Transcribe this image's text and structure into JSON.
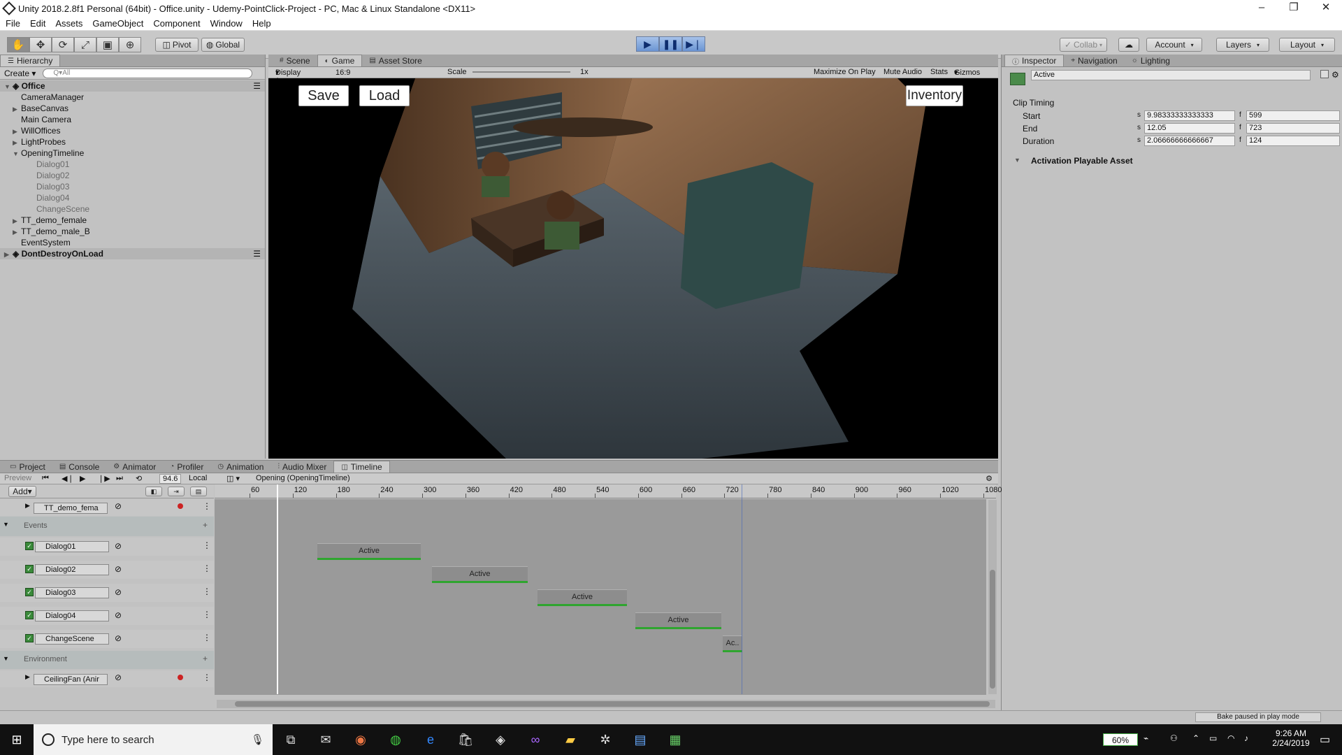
{
  "window": {
    "title": "Unity 2018.2.8f1 Personal (64bit) - Office.unity - Udemy-PointClick-Project - PC, Mac & Linux Standalone <DX11>"
  },
  "menu": [
    "File",
    "Edit",
    "Assets",
    "GameObject",
    "Component",
    "Window",
    "Help"
  ],
  "toolbar": {
    "pivot": "Pivot",
    "global": "Global",
    "collab": "Collab",
    "account": "Account",
    "layers": "Layers",
    "layout": "Layout"
  },
  "hierarchy": {
    "tab": "Hierarchy",
    "create": "Create",
    "search_placeholder": "Q▾All",
    "items": [
      {
        "label": "Office",
        "type": "scene",
        "expanded": true
      },
      {
        "label": "CameraManager",
        "indent": 1
      },
      {
        "label": "BaseCanvas",
        "indent": 1,
        "collapsed": true
      },
      {
        "label": "Main Camera",
        "indent": 1
      },
      {
        "label": "WillOffices",
        "indent": 1,
        "collapsed": true
      },
      {
        "label": "LightProbes",
        "indent": 1,
        "collapsed": true
      },
      {
        "label": "OpeningTimeline",
        "indent": 1,
        "expanded": true
      },
      {
        "label": "Dialog01",
        "indent": 2,
        "dim": true
      },
      {
        "label": "Dialog02",
        "indent": 2,
        "dim": true
      },
      {
        "label": "Dialog03",
        "indent": 2,
        "dim": true
      },
      {
        "label": "Dialog04",
        "indent": 2,
        "dim": true
      },
      {
        "label": "ChangeScene",
        "indent": 2,
        "dim": true
      },
      {
        "label": "TT_demo_female",
        "indent": 1,
        "collapsed": true
      },
      {
        "label": "TT_demo_male_B",
        "indent": 1,
        "collapsed": true
      },
      {
        "label": "EventSystem",
        "indent": 1
      },
      {
        "label": "DontDestroyOnLoad",
        "type": "scene",
        "collapsed": true
      }
    ]
  },
  "gameview": {
    "tabs": [
      "Scene",
      "Game",
      "Asset Store"
    ],
    "active_tab": "Game",
    "display": "Display 1",
    "aspect": "16:9",
    "scale_label": "Scale",
    "scale_value": "1x",
    "toggles": [
      "Maximize On Play",
      "Mute Audio",
      "Stats",
      "Gizmos"
    ],
    "buttons": {
      "save": "Save",
      "load": "Load",
      "inventory": "Inventory"
    }
  },
  "inspector": {
    "tabs": [
      "Inspector",
      "Navigation",
      "Lighting"
    ],
    "name": "Active",
    "clip_timing": "Clip Timing",
    "rows": [
      {
        "label": "Start",
        "s": "9.98333333333333",
        "f": "599"
      },
      {
        "label": "End",
        "s": "12.05",
        "f": "723"
      },
      {
        "label": "Duration",
        "s": "2.06666666666667",
        "f": "124"
      }
    ],
    "unit_s": "s",
    "unit_f": "f",
    "section": "Activation Playable Asset"
  },
  "timeline": {
    "tabs": [
      "Project",
      "Console",
      "Animator",
      "Profiler",
      "Animation",
      "Audio Mixer",
      "Timeline"
    ],
    "active_tab": "Timeline",
    "preview": "Preview",
    "frame": "94.6",
    "local": "Local",
    "asset": "Opening (OpeningTimeline)",
    "add": "Add",
    "ruler": [
      "60",
      "120",
      "180",
      "240",
      "300",
      "360",
      "420",
      "480",
      "540",
      "600",
      "660",
      "720",
      "780",
      "840",
      "900",
      "960",
      "1020",
      "1080"
    ],
    "groups": {
      "events": "Events",
      "environment": "Environment"
    },
    "tracks": [
      {
        "label": "TT_demo_fema"
      },
      {
        "label": "Dialog01"
      },
      {
        "label": "Dialog02"
      },
      {
        "label": "Dialog03"
      },
      {
        "label": "Dialog04"
      },
      {
        "label": "ChangeScene"
      },
      {
        "label": "CeilingFan (Anir"
      }
    ],
    "clips": [
      "Active",
      "Active",
      "Active",
      "Active",
      "Ac.."
    ]
  },
  "status": {
    "bake": "Bake paused in play mode"
  },
  "taskbar": {
    "search": "Type here to search",
    "battery": "60%",
    "time": "9:26 AM",
    "date": "2/24/2019"
  }
}
